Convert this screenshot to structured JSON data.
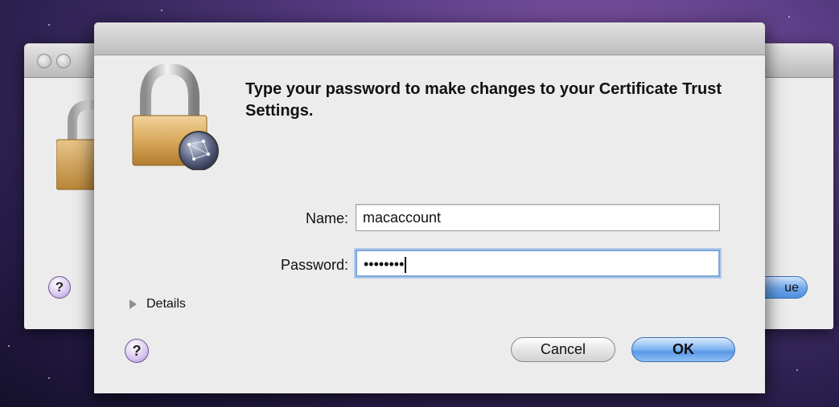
{
  "background_window": {
    "help_label": "?",
    "button_label": "ue"
  },
  "dialog": {
    "message": "Type your password to make changes to your Certificate Trust Settings.",
    "name_label": "Name:",
    "name_value": "macaccount",
    "password_label": "Password:",
    "password_value": "••••••••",
    "details_label": "Details",
    "help_label": "?",
    "cancel_label": "Cancel",
    "ok_label": "OK"
  },
  "icons": {
    "lock": "lock-icon",
    "globe_badge": "network-globe-icon",
    "disclosure": "disclosure-triangle-icon"
  },
  "colors": {
    "accent": "#5898e6",
    "help_purple": "#d9c6f0",
    "dialog_bg": "#ececec"
  }
}
